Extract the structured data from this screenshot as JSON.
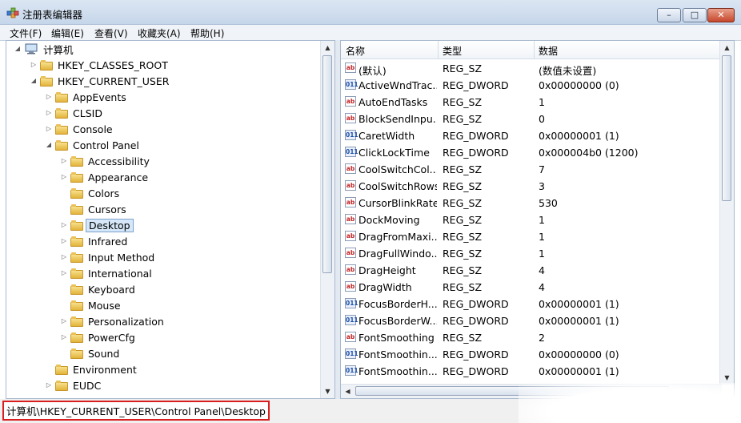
{
  "window": {
    "title": "注册表编辑器",
    "buttons": {
      "minimize": "–",
      "maximize": "□",
      "close": "✕"
    }
  },
  "menu": [
    "文件(F)",
    "编辑(E)",
    "查看(V)",
    "收藏夹(A)",
    "帮助(H)"
  ],
  "tree": {
    "root": "计算机",
    "items": [
      {
        "label": "HKEY_CLASSES_ROOT",
        "level": 1,
        "expander": "collapsed"
      },
      {
        "label": "HKEY_CURRENT_USER",
        "level": 1,
        "expander": "expanded"
      },
      {
        "label": "AppEvents",
        "level": 2,
        "expander": "collapsed"
      },
      {
        "label": "CLSID",
        "level": 2,
        "expander": "collapsed"
      },
      {
        "label": "Console",
        "level": 2,
        "expander": "collapsed"
      },
      {
        "label": "Control Panel",
        "level": 2,
        "expander": "expanded"
      },
      {
        "label": "Accessibility",
        "level": 3,
        "expander": "collapsed"
      },
      {
        "label": "Appearance",
        "level": 3,
        "expander": "collapsed"
      },
      {
        "label": "Colors",
        "level": 3,
        "expander": "none"
      },
      {
        "label": "Cursors",
        "level": 3,
        "expander": "none"
      },
      {
        "label": "Desktop",
        "level": 3,
        "expander": "collapsed",
        "selected": true
      },
      {
        "label": "Infrared",
        "level": 3,
        "expander": "collapsed"
      },
      {
        "label": "Input Method",
        "level": 3,
        "expander": "collapsed"
      },
      {
        "label": "International",
        "level": 3,
        "expander": "collapsed"
      },
      {
        "label": "Keyboard",
        "level": 3,
        "expander": "none"
      },
      {
        "label": "Mouse",
        "level": 3,
        "expander": "none"
      },
      {
        "label": "Personalization",
        "level": 3,
        "expander": "collapsed"
      },
      {
        "label": "PowerCfg",
        "level": 3,
        "expander": "collapsed"
      },
      {
        "label": "Sound",
        "level": 3,
        "expander": "none"
      },
      {
        "label": "Environment",
        "level": 2,
        "expander": "none"
      },
      {
        "label": "EUDC",
        "level": 2,
        "expander": "collapsed"
      }
    ]
  },
  "list": {
    "columns": [
      "名称",
      "类型",
      "数据"
    ],
    "rows": [
      {
        "icon": "sz",
        "name": "(默认)",
        "type": "REG_SZ",
        "data": "(数值未设置)"
      },
      {
        "icon": "dw",
        "name": "ActiveWndTrac...",
        "type": "REG_DWORD",
        "data": "0x00000000 (0)"
      },
      {
        "icon": "sz",
        "name": "AutoEndTasks",
        "type": "REG_SZ",
        "data": "1"
      },
      {
        "icon": "sz",
        "name": "BlockSendInpu...",
        "type": "REG_SZ",
        "data": "0"
      },
      {
        "icon": "dw",
        "name": "CaretWidth",
        "type": "REG_DWORD",
        "data": "0x00000001 (1)"
      },
      {
        "icon": "dw",
        "name": "ClickLockTime",
        "type": "REG_DWORD",
        "data": "0x000004b0 (1200)"
      },
      {
        "icon": "sz",
        "name": "CoolSwitchCol...",
        "type": "REG_SZ",
        "data": "7"
      },
      {
        "icon": "sz",
        "name": "CoolSwitchRows",
        "type": "REG_SZ",
        "data": "3"
      },
      {
        "icon": "sz",
        "name": "CursorBlinkRate",
        "type": "REG_SZ",
        "data": "530"
      },
      {
        "icon": "sz",
        "name": "DockMoving",
        "type": "REG_SZ",
        "data": "1"
      },
      {
        "icon": "sz",
        "name": "DragFromMaxi...",
        "type": "REG_SZ",
        "data": "1"
      },
      {
        "icon": "sz",
        "name": "DragFullWindo...",
        "type": "REG_SZ",
        "data": "1"
      },
      {
        "icon": "sz",
        "name": "DragHeight",
        "type": "REG_SZ",
        "data": "4"
      },
      {
        "icon": "sz",
        "name": "DragWidth",
        "type": "REG_SZ",
        "data": "4"
      },
      {
        "icon": "dw",
        "name": "FocusBorderH...",
        "type": "REG_DWORD",
        "data": "0x00000001 (1)"
      },
      {
        "icon": "dw",
        "name": "FocusBorderW...",
        "type": "REG_DWORD",
        "data": "0x00000001 (1)"
      },
      {
        "icon": "sz",
        "name": "FontSmoothing",
        "type": "REG_SZ",
        "data": "2"
      },
      {
        "icon": "dw",
        "name": "FontSmoothin...",
        "type": "REG_DWORD",
        "data": "0x00000000 (0)"
      },
      {
        "icon": "dw",
        "name": "FontSmoothin...",
        "type": "REG_DWORD",
        "data": "0x00000001 (1)"
      }
    ]
  },
  "icons": {
    "string_value": "ab",
    "binary_value": "011"
  },
  "status": {
    "path": "计算机\\HKEY_CURRENT_USER\\Control Panel\\Desktop"
  }
}
